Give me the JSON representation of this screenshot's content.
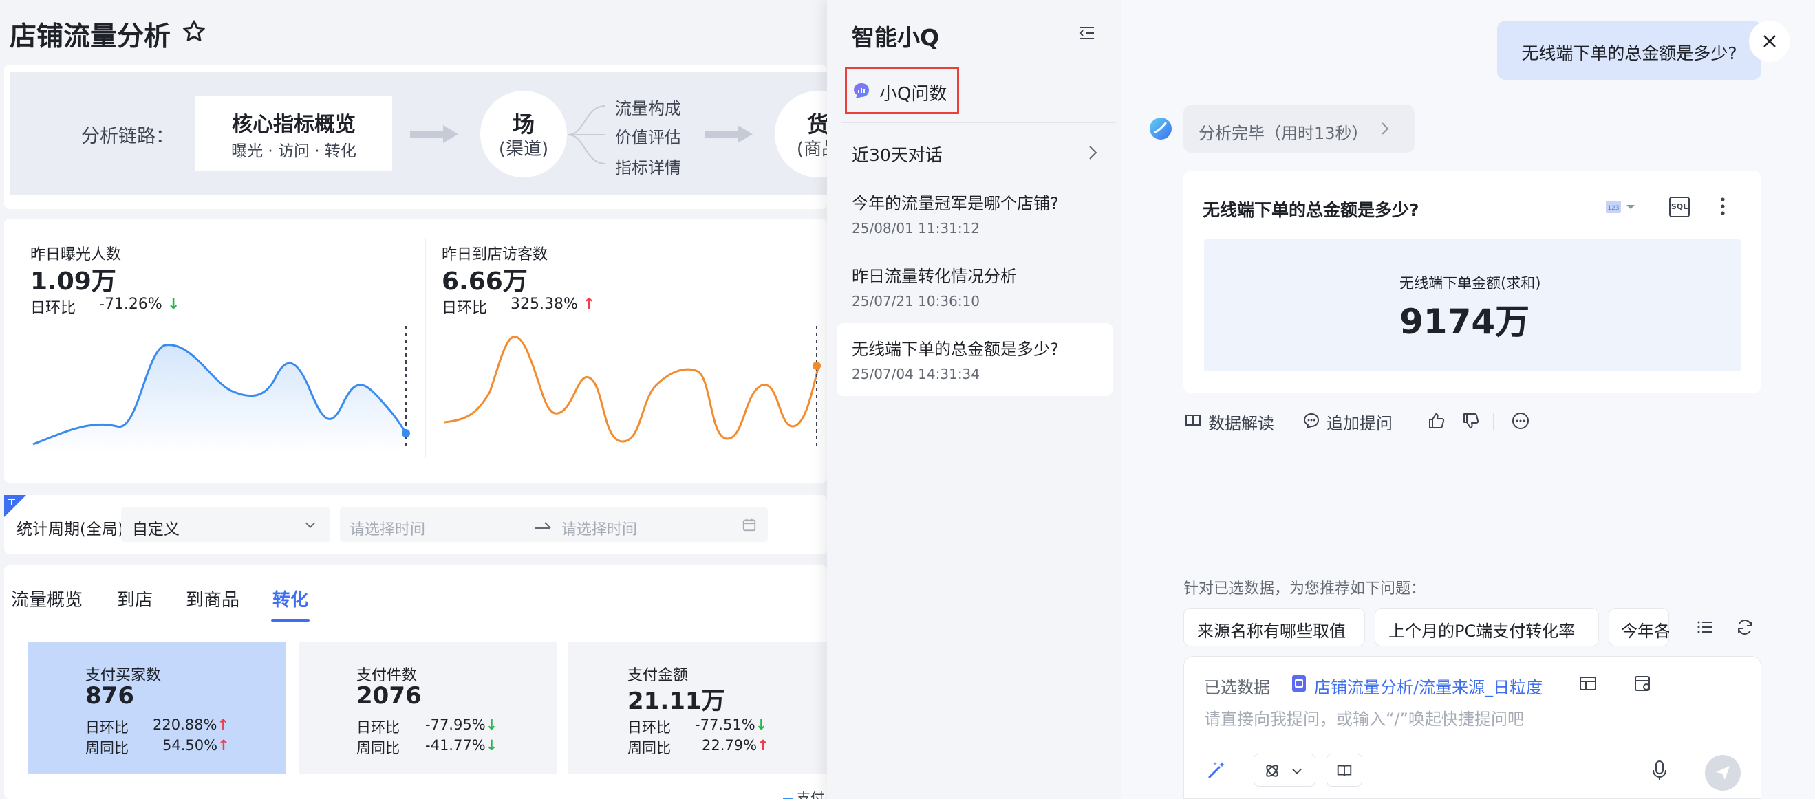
{
  "dashboard": {
    "title": "店铺流量分析",
    "chain": {
      "label": "分析链路：",
      "core_title": "核心指标概览",
      "core_sub": "曝光 · 访问 · 转化",
      "node1_main": "场",
      "node1_sub": "(渠道)",
      "branches": [
        "流量构成",
        "价值评估",
        "指标详情"
      ],
      "node2_main": "货",
      "node2_sub": "(商品"
    },
    "metrics": [
      {
        "label": "昨日曝光人数",
        "value": "1.09万",
        "change_label": "日环比",
        "change": "-71.26%",
        "direction": "down"
      },
      {
        "label": "昨日到店访客数",
        "value": "6.66万",
        "change_label": "日环比",
        "change": "325.38%",
        "direction": "up"
      }
    ],
    "filter": {
      "label": "统计周期(全局)",
      "select_value": "自定义",
      "start_placeholder": "请选择时间",
      "end_placeholder": "请选择时间"
    },
    "tabs": [
      "流量概览",
      "到店",
      "到商品",
      "转化"
    ],
    "active_tab": "转化",
    "kpis": [
      {
        "label": "支付买家数",
        "value": "876",
        "r1_label": "日环比",
        "r1": "220.88%",
        "r2_label": "周同比",
        "r2": "54.50%"
      },
      {
        "label": "支付件数",
        "value": "2076",
        "r1_label": "日环比",
        "r1": "-77.95%",
        "r2_label": "周同比",
        "r2": "-41.77%"
      },
      {
        "label": "支付金额",
        "value": "21.11万",
        "r1_label": "日环比",
        "r1": "-77.51%",
        "r2_label": "周同比",
        "r2": "22.79%"
      }
    ],
    "legend_fragment": "支付"
  },
  "sidebar": {
    "title": "智能小Q",
    "entry": "小Q问数",
    "recent_label": "近30天对话",
    "history": [
      {
        "title": "今年的流量冠军是哪个店铺?",
        "time": "25/08/01 11:31:12"
      },
      {
        "title": "昨日流量转化情况分析",
        "time": "25/07/21 10:36:10"
      },
      {
        "title": "无线端下单的总金额是多少?",
        "time": "25/07/04 14:31:34"
      }
    ]
  },
  "chat": {
    "user_question": "无线端下单的总金额是多少?",
    "status": "分析完毕（用时13秒）",
    "answer_title": "无线端下单的总金额是多少?",
    "sql_label": "SQL",
    "kpi_label": "无线端下单金额(求和)",
    "kpi_value": "9174万",
    "actions": [
      "数据解读",
      "追加提问"
    ],
    "suggest_title": "针对已选数据，为您推荐如下问题：",
    "suggestions": [
      "来源名称有哪些取值",
      "上个月的PC端支付转化率",
      "今年各"
    ],
    "selected_label": "已选数据",
    "selected_dataset": "店铺流量分析/流量来源_日粒度",
    "input_placeholder": "请直接向我提问，或输入“/”唤起快捷提问吧"
  },
  "colors": {
    "accent": "#3e6ff0",
    "series_blue": "#3a8bee",
    "series_orange": "#f28c2f",
    "up": "#f23c4c",
    "down": "#21b84a",
    "highlight_border": "#e8413b"
  }
}
